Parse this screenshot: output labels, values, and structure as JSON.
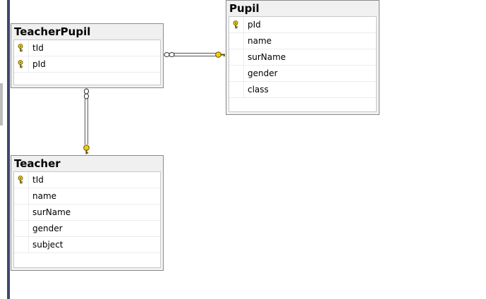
{
  "tables": {
    "teacher_pupil": {
      "title": "TeacherPupil",
      "columns": [
        {
          "name": "tId",
          "key": true
        },
        {
          "name": "pId",
          "key": true
        }
      ]
    },
    "pupil": {
      "title": "Pupil",
      "columns": [
        {
          "name": "pId",
          "key": true
        },
        {
          "name": "name",
          "key": false
        },
        {
          "name": "surName",
          "key": false
        },
        {
          "name": "gender",
          "key": false
        },
        {
          "name": "class",
          "key": false
        }
      ]
    },
    "teacher": {
      "title": "Teacher",
      "columns": [
        {
          "name": "tId",
          "key": true
        },
        {
          "name": "name",
          "key": false
        },
        {
          "name": "surName",
          "key": false
        },
        {
          "name": "gender",
          "key": false
        },
        {
          "name": "subject",
          "key": false
        }
      ]
    }
  },
  "relationships": [
    {
      "from": "teacher_pupil",
      "to": "pupil",
      "from_end": "many",
      "to_end": "one"
    },
    {
      "from": "teacher_pupil",
      "to": "teacher",
      "from_end": "many",
      "to_end": "one"
    }
  ],
  "colors": {
    "key_fill": "#f2d000",
    "key_stroke": "#6b5a00",
    "line": "#6e6e6e",
    "frame_border": "#3a4a6b"
  },
  "icons": {
    "primary_key": "key-icon"
  }
}
